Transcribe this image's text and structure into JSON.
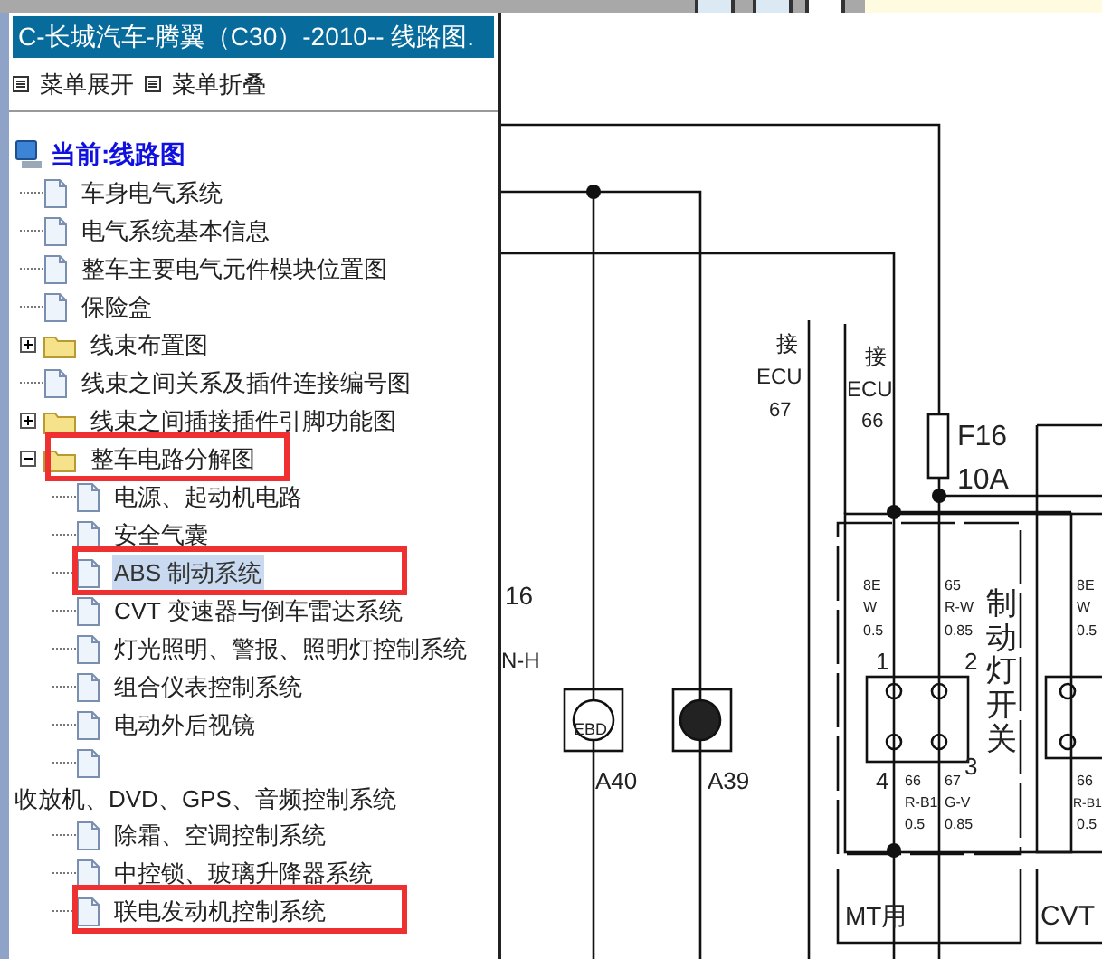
{
  "panel": {
    "title": "C-长城汽车-腾翼（C30）-2010-- 线路图.",
    "menu": [
      {
        "label": "菜单展开"
      },
      {
        "label": "菜单折叠"
      }
    ]
  },
  "tree": {
    "label": "当前:线路图",
    "children": [
      {
        "label": "车身电气系统",
        "kind": "page",
        "selected": false,
        "highlighted": false
      },
      {
        "label": "电气系统基本信息",
        "kind": "page",
        "selected": false,
        "highlighted": false
      },
      {
        "label": "整车主要电气元件模块位置图",
        "kind": "page",
        "selected": false,
        "highlighted": false
      },
      {
        "label": "保险盒",
        "kind": "page",
        "selected": false,
        "highlighted": false
      },
      {
        "label": "线束布置图",
        "kind": "folder",
        "expanded": false,
        "selected": false,
        "highlighted": false
      },
      {
        "label": "线束之间关系及插件连接编号图",
        "kind": "page",
        "selected": false,
        "highlighted": false
      },
      {
        "label": "线束之间插接插件引脚功能图",
        "kind": "folder",
        "expanded": false,
        "selected": false,
        "highlighted": false
      },
      {
        "label": "整车电路分解图",
        "kind": "folder",
        "expanded": true,
        "selected": false,
        "highlighted": true,
        "children": [
          {
            "label": "电源、起动机电路",
            "kind": "page",
            "selected": false,
            "highlighted": false
          },
          {
            "label": "安全气囊",
            "kind": "page",
            "selected": false,
            "highlighted": false
          },
          {
            "label": "ABS 制动系统",
            "kind": "page",
            "selected": true,
            "highlighted": true
          },
          {
            "label": "CVT 变速器与倒车雷达系统",
            "kind": "page",
            "selected": false,
            "highlighted": false
          },
          {
            "label": "灯光照明、警报、照明灯控制系统",
            "kind": "page",
            "selected": false,
            "highlighted": false
          },
          {
            "label": "组合仪表控制系统",
            "kind": "page",
            "selected": false,
            "highlighted": false
          },
          {
            "label": "电动外后视镜",
            "kind": "page",
            "selected": false,
            "highlighted": false
          },
          {
            "label": "收放机、DVD、GPS、音频控制系统",
            "kind": "wrapped",
            "selected": false,
            "highlighted": false
          },
          {
            "label": "除霜、空调控制系统",
            "kind": "page",
            "selected": false,
            "highlighted": false
          },
          {
            "label": "中控锁、玻璃升降器系统",
            "kind": "page",
            "selected": false,
            "highlighted": false
          },
          {
            "label": "联电发动机控制系统",
            "kind": "page",
            "selected": false,
            "highlighted": true
          }
        ]
      }
    ]
  },
  "diagram": {
    "labels": [
      "接",
      "ECU",
      "67",
      "接",
      "ECU",
      "66",
      "F16",
      "10A",
      "16",
      "N-H",
      "EBD",
      "A40",
      "A39",
      "1",
      "2",
      "4",
      "3",
      "8E",
      "W",
      "0.5",
      "65",
      "R-W",
      "0.85",
      "66",
      "R-B1",
      "0.5",
      "67",
      "G-V",
      "0.85",
      "8E",
      "W",
      "0.5",
      "66",
      "R-B1",
      "0.5",
      "MT用",
      "CVT"
    ],
    "switch_title": "制动灯开关"
  }
}
